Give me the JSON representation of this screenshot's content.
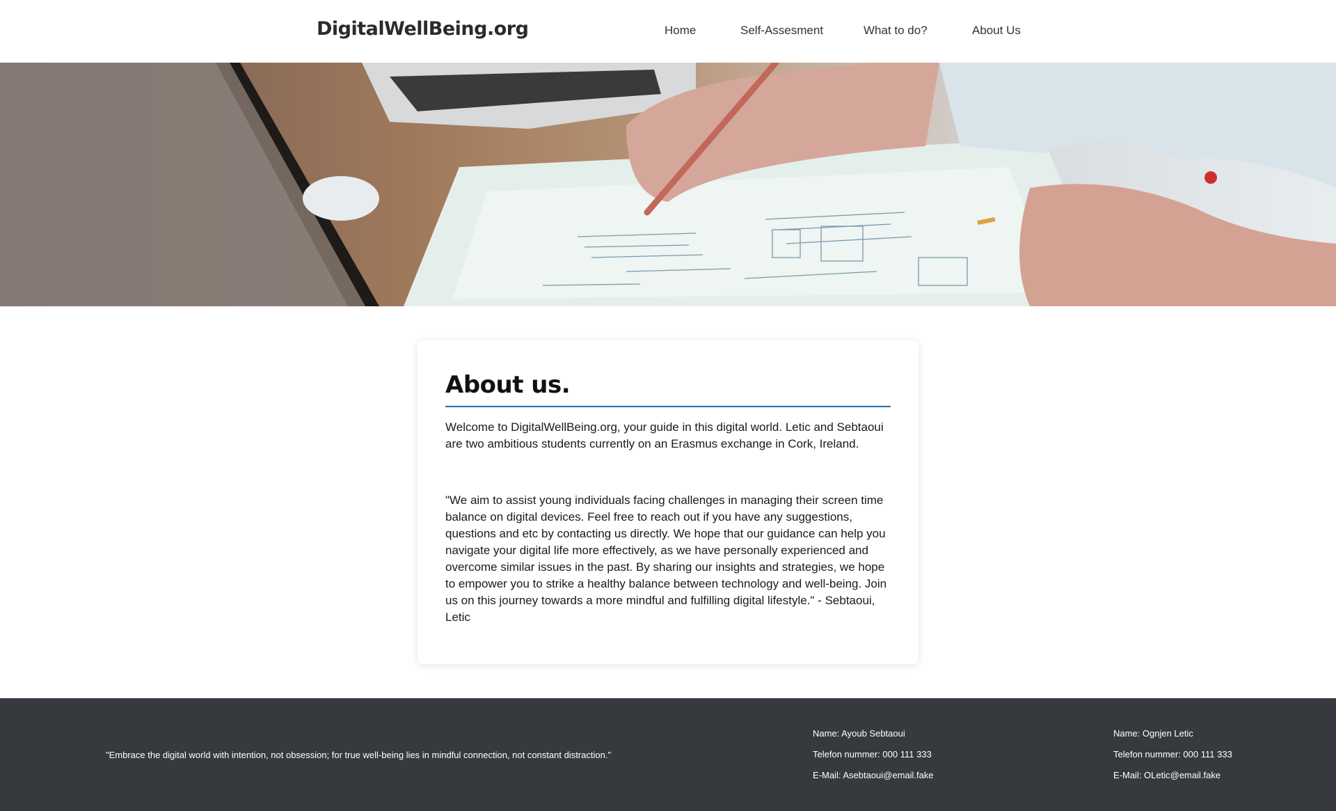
{
  "header": {
    "logo": "DigitalWellBeing.org",
    "nav": [
      {
        "label": "Home"
      },
      {
        "label": "Self-Assesment"
      },
      {
        "label": "What to do?"
      },
      {
        "label": "About Us"
      }
    ]
  },
  "about": {
    "title": "About us.",
    "intro": "Welcome to DigitalWellBeing.org, your guide in this digital world. Letic and Sebtaoui are two ambitious students currently on an Erasmus exchange in Cork, Ireland.",
    "quote": "\"We aim to assist young individuals facing challenges in managing their screen time balance on digital devices. Feel free to reach out if you have any suggestions, questions and etc by contacting us directly. We hope that our guidance can help you navigate your digital life more effectively, as we have personally experienced and overcome similar issues in the past. By sharing our insights and strategies, we hope to empower you to strike a healthy balance between technology and well-being. Join us on this journey towards a more mindful and fulfilling digital lifestyle.\" - Sebtaoui, Letic"
  },
  "footer": {
    "motto": "\"Embrace the digital world with intention, not obsession; for true well-being lies in mindful connection, not constant distraction.\"",
    "contacts": [
      {
        "name": "Name: Ayoub Sebtaoui",
        "phone": "Telefon nummer: 000 111 333",
        "email": "E-Mail: Asebtaoui@email.fake"
      },
      {
        "name": "Name: Ognjen Letic",
        "phone": "Telefon nummer: 000 111 333",
        "email": "E-Mail: OLetic@email.fake"
      }
    ]
  }
}
